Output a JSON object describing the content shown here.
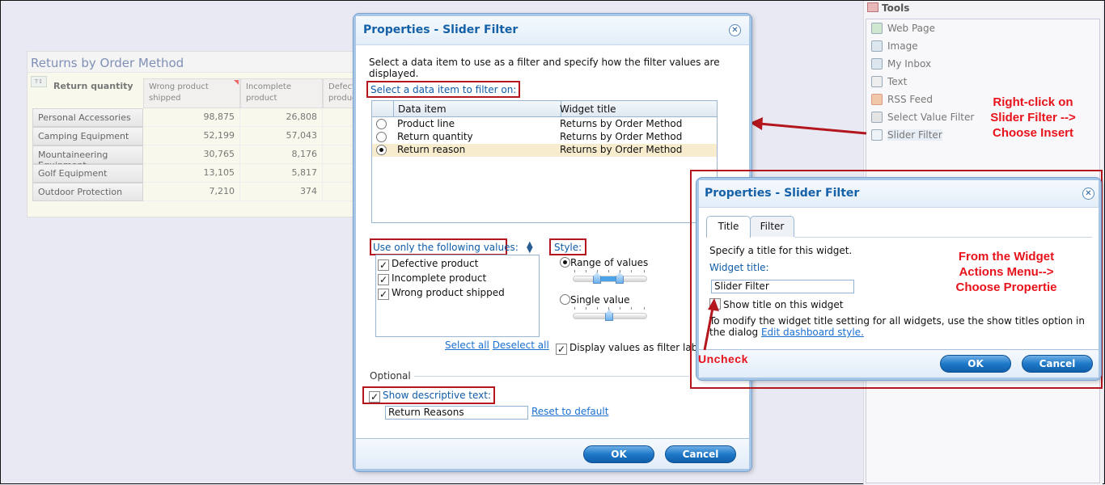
{
  "report": {
    "title": "Returns by Order Method",
    "row_header_label": "Return quantity",
    "columns": [
      "Wrong product shipped",
      "Incomplete product",
      "Defective product"
    ],
    "rows": [
      {
        "label": "Personal Accessories",
        "values": [
          "98,875",
          "26,808"
        ]
      },
      {
        "label": "Camping Equipment",
        "values": [
          "52,199",
          "57,043"
        ]
      },
      {
        "label": "Mountaineering Equipment",
        "values": [
          "30,765",
          "8,176"
        ]
      },
      {
        "label": "Golf Equipment",
        "values": [
          "13,105",
          "5,817"
        ]
      },
      {
        "label": "Outdoor Protection",
        "values": [
          "7,210",
          "374"
        ]
      }
    ]
  },
  "tools": {
    "header": "Tools",
    "items": [
      {
        "label": "Web Page",
        "icon": "web-page-icon"
      },
      {
        "label": "Image",
        "icon": "image-icon"
      },
      {
        "label": "My Inbox",
        "icon": "inbox-icon"
      },
      {
        "label": "Text",
        "icon": "text-icon"
      },
      {
        "label": "RSS Feed",
        "icon": "rss-feed-icon"
      },
      {
        "label": "Select Value Filter",
        "icon": "select-value-filter-icon"
      },
      {
        "label": "Slider Filter",
        "icon": "slider-filter-icon"
      }
    ]
  },
  "main_dialog": {
    "title": "Properties - Slider Filter",
    "instructions": "Select a data item to use as a filter and specify how the filter values are displayed.",
    "data_item_label": "Select a data item to filter on:",
    "table_headers": [
      "Data item",
      "Widget title"
    ],
    "data_items": [
      {
        "name": "Product line",
        "widget_title": "Returns by Order Method",
        "selected": false
      },
      {
        "name": "Return quantity",
        "widget_title": "Returns by Order Method",
        "selected": false
      },
      {
        "name": "Return reason",
        "widget_title": "Returns by Order Method",
        "selected": true
      }
    ],
    "values_label": "Use only the following values:",
    "values": [
      {
        "label": "Defective product",
        "checked": true
      },
      {
        "label": "Incomplete product",
        "checked": true
      },
      {
        "label": "Wrong product shipped",
        "checked": true
      }
    ],
    "select_all": "Select all",
    "deselect_all": "Deselect all",
    "style_label": "Style:",
    "style_options": [
      {
        "label": "Range of values",
        "selected": true
      },
      {
        "label": "Single value",
        "selected": false
      }
    ],
    "display_values_label": "Display values as filter labels",
    "display_values_checked": true,
    "optional_label": "Optional",
    "show_descriptive_label": "Show descriptive text:",
    "show_descriptive_checked": true,
    "descriptive_text_value": "Return Reasons",
    "reset_default": "Reset to default",
    "ok": "OK",
    "cancel": "Cancel"
  },
  "second_dialog": {
    "title": "Properties - Slider Filter",
    "tabs": [
      {
        "label": "Title",
        "active": true
      },
      {
        "label": "Filter",
        "active": false
      }
    ],
    "instruction": "Specify a title for this widget.",
    "widget_title_label": "Widget title:",
    "widget_title_value": "Slider Filter",
    "show_title_label": "Show title on this widget",
    "show_title_checked": false,
    "note_text": "To modify the widget title setting for all widgets, use the show titles option in the dialog",
    "note_link": "Edit dashboard style.",
    "ok": "OK",
    "cancel": "Cancel"
  },
  "annotations": {
    "right_click": "Right-click on Slider Filter --> Choose Insert",
    "right_click_lines": [
      "Right-click on",
      "Slider Filter -->",
      "Choose Insert"
    ],
    "widget_actions_lines": [
      "From the Widget",
      "Actions Menu-->",
      "Choose Propertie"
    ],
    "uncheck": "Uncheck",
    "color": "#e8121b",
    "box_color": "#b3161c"
  }
}
